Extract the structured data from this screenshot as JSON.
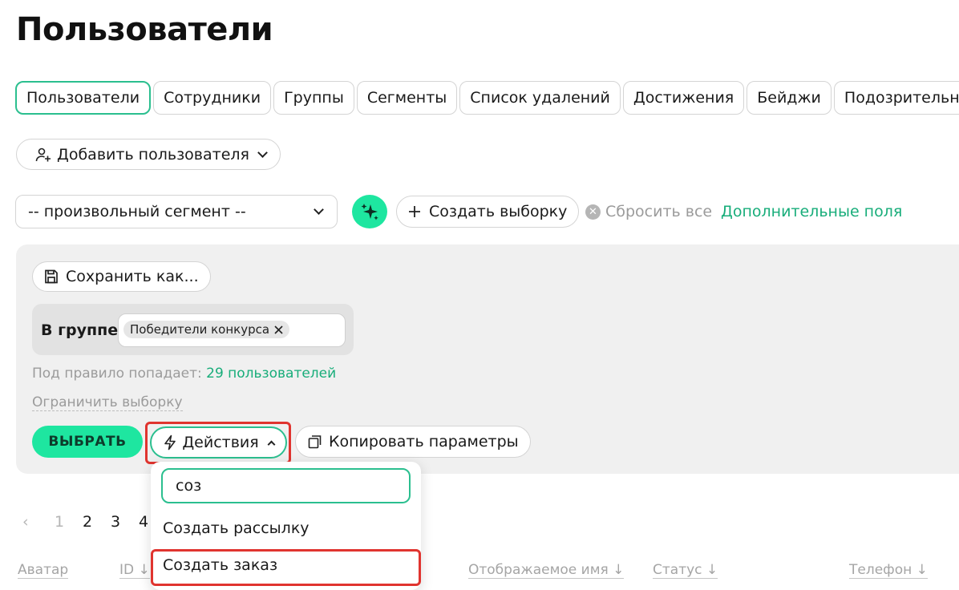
{
  "page": {
    "title": "Пользователи"
  },
  "tabs": [
    {
      "label": "Пользователи",
      "active": true
    },
    {
      "label": "Сотрудники"
    },
    {
      "label": "Группы"
    },
    {
      "label": "Сегменты"
    },
    {
      "label": "Список удалений"
    },
    {
      "label": "Достижения"
    },
    {
      "label": "Бейджи"
    },
    {
      "label": "Подозрительные"
    }
  ],
  "toolbar": {
    "add_user_label": "Добавить пользователя",
    "segment_value": "-- произвольный сегмент --",
    "create_selection_label": "Создать выборку",
    "reset_all_label": "Сбросить все",
    "extra_fields_label": "Дополнительные поля"
  },
  "filter": {
    "save_as_label": "Сохранить как...",
    "rule_label": "В группе",
    "rule_chip": "Победители конкурса",
    "count_prefix": "Под правило попадает: ",
    "count_link": "29 пользователей",
    "limit_label": "Ограничить выборку",
    "select_label": "ВЫБРАТЬ",
    "actions_label": "Действия",
    "copy_params_label": "Копировать параметры"
  },
  "actions_dropdown": {
    "search_value": "соз",
    "items": [
      "Создать рассылку",
      "Создать заказ"
    ]
  },
  "pagination": {
    "prev": "‹",
    "pages": [
      "1",
      "2",
      "3",
      "4"
    ],
    "current": "1"
  },
  "table": {
    "columns": [
      "Аватар",
      "ID ↓",
      "Отображаемое имя ↓",
      "Статус ↓",
      "Телефон ↓"
    ]
  },
  "colors": {
    "accent": "#1ee6a0",
    "accent_border": "#2bbf8f",
    "link": "#18ad7a",
    "highlight": "#e0342f"
  }
}
